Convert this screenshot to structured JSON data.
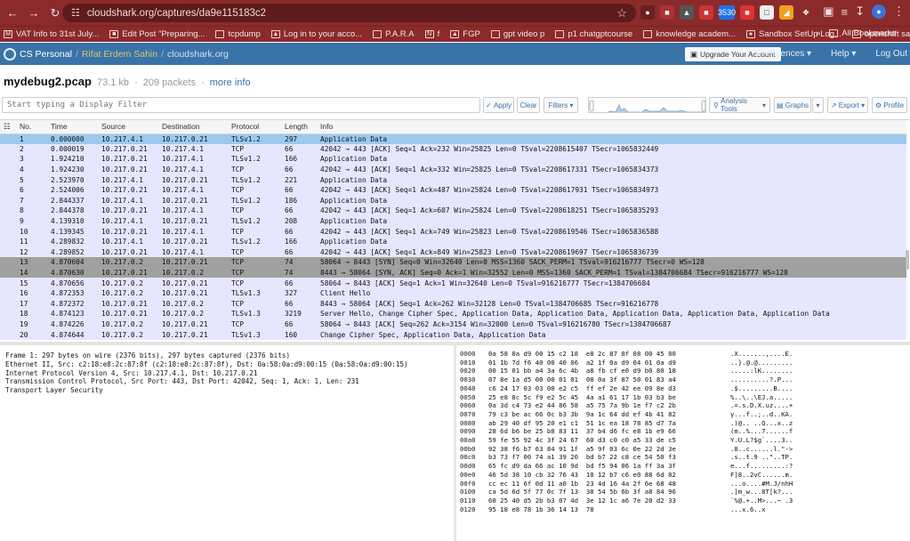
{
  "browser": {
    "url": "cloudshark.org/captures/da9e115183c2",
    "bookmarks": [
      "VAT Info to 31st July...",
      "Edit Post \"Preparing...",
      "tcpdump",
      "Log in to your acco...",
      "P.A.R.A",
      "f",
      "FGP",
      "gpt video p",
      "p1 chatgptcourse",
      "knowledge academ...",
      "Sandbox SetUp Log...",
      "openshift sandbox"
    ],
    "all_bookmarks": "All Bookmarks",
    "badge": "3530"
  },
  "app": {
    "workspace": "CS Personal",
    "user": "Rifat Erdem Sahin",
    "site": "cloudshark.org",
    "upgrade": "Upgrade Your Account",
    "menu": [
      "Preferences",
      "Help",
      "Log Out"
    ]
  },
  "capture": {
    "title": "mydebug2.pcap",
    "size": "73.1 kb",
    "packets": "209 packets",
    "more_info": "more info"
  },
  "toolbar": {
    "filter_placeholder": "Start typing a Display Filter",
    "apply": "Apply",
    "clear": "Clear",
    "filters": "Filters",
    "analysis": "Analysis Tools",
    "graphs": "Graphs",
    "export": "Export",
    "profile": "Profile"
  },
  "table": {
    "columns": [
      "No.",
      "Time",
      "Source",
      "Destination",
      "Protocol",
      "Length",
      "Info"
    ],
    "rows": [
      [
        "1",
        "0.000000",
        "10.217.4.1",
        "10.217.0.21",
        "TLSv1.2",
        "297",
        "Application Data"
      ],
      [
        "2",
        "0.000019",
        "10.217.0.21",
        "10.217.4.1",
        "TCP",
        "66",
        "42042 → 443 [ACK] Seq=1 Ack=232 Win=25825 Len=0 TSval=2208615407 TSecr=1065832449"
      ],
      [
        "3",
        "1.924210",
        "10.217.0.21",
        "10.217.4.1",
        "TLSv1.2",
        "166",
        "Application Data"
      ],
      [
        "4",
        "1.924230",
        "10.217.0.21",
        "10.217.4.1",
        "TCP",
        "66",
        "42042 → 443 [ACK] Seq=1 Ack=332 Win=25825 Len=0 TSval=2208617331 TSecr=1065834373"
      ],
      [
        "5",
        "2.523970",
        "10.217.4.1",
        "10.217.0.21",
        "TLSv1.2",
        "221",
        "Application Data"
      ],
      [
        "6",
        "2.524006",
        "10.217.0.21",
        "10.217.4.1",
        "TCP",
        "66",
        "42042 → 443 [ACK] Seq=1 Ack=487 Win=25824 Len=0 TSval=2208617931 TSecr=1065834973"
      ],
      [
        "7",
        "2.844337",
        "10.217.4.1",
        "10.217.0.21",
        "TLSv1.2",
        "186",
        "Application Data"
      ],
      [
        "8",
        "2.844378",
        "10.217.0.21",
        "10.217.4.1",
        "TCP",
        "66",
        "42042 → 443 [ACK] Seq=1 Ack=607 Win=25824 Len=0 TSval=2208618251 TSecr=1065835293"
      ],
      [
        "9",
        "4.139310",
        "10.217.4.1",
        "10.217.0.21",
        "TLSv1.2",
        "208",
        "Application Data"
      ],
      [
        "10",
        "4.139345",
        "10.217.0.21",
        "10.217.4.1",
        "TCP",
        "66",
        "42042 → 443 [ACK] Seq=1 Ack=749 Win=25823 Len=0 TSval=2208619546 TSecr=1065836588"
      ],
      [
        "11",
        "4.289832",
        "10.217.4.1",
        "10.217.0.21",
        "TLSv1.2",
        "166",
        "Application Data"
      ],
      [
        "12",
        "4.289852",
        "10.217.0.21",
        "10.217.4.1",
        "TCP",
        "66",
        "42042 → 443 [ACK] Seq=1 Ack=849 Win=25823 Len=0 TSval=2208619697 TSecr=1065836739"
      ],
      [
        "13",
        "4.870604",
        "10.217.0.2",
        "10.217.0.21",
        "TCP",
        "74",
        "58064 → 8443 [SYN] Seq=0 Win=32640 Len=0 MSS=1360 SACK_PERM=1 TSval=916216777 TSecr=0 WS=128"
      ],
      [
        "14",
        "4.870630",
        "10.217.0.21",
        "10.217.0.2",
        "TCP",
        "74",
        "8443 → 58064 [SYN, ACK] Seq=0 Ack=1 Win=32552 Len=0 MSS=1360 SACK_PERM=1 TSval=1384706684 TSecr=916216777 WS=128"
      ],
      [
        "15",
        "4.870656",
        "10.217.0.2",
        "10.217.0.21",
        "TCP",
        "66",
        "58064 → 8443 [ACK] Seq=1 Ack=1 Win=32640 Len=0 TSval=916216777 TSecr=1384706684"
      ],
      [
        "16",
        "4.872353",
        "10.217.0.2",
        "10.217.0.21",
        "TLSv1.3",
        "327",
        "Client Hello"
      ],
      [
        "17",
        "4.872372",
        "10.217.0.21",
        "10.217.0.2",
        "TCP",
        "66",
        "8443 → 58064 [ACK] Seq=1 Ack=262 Win=32128 Len=0 TSval=1384706685 TSecr=916216778"
      ],
      [
        "18",
        "4.874123",
        "10.217.0.21",
        "10.217.0.2",
        "TLSv1.3",
        "3219",
        "Server Hello, Change Cipher Spec, Application Data, Application Data, Application Data, Application Data, Application Data"
      ],
      [
        "19",
        "4.874226",
        "10.217.0.2",
        "10.217.0.21",
        "TCP",
        "66",
        "58064 → 8443 [ACK] Seq=262 Ack=3154 Win=32000 Len=0 TSval=916216780 TSecr=1384706687"
      ],
      [
        "20",
        "4.874644",
        "10.217.0.2",
        "10.217.0.21",
        "TLSv1.3",
        "160",
        "Change Cipher Spec, Application Data, Application Data"
      ]
    ]
  },
  "details": [
    "Frame 1: 297 bytes on wire (2376 bits), 297 bytes captured (2376 bits)",
    "Ethernet II, Src: c2:18:e8:2c:87:8f (c2:18:e8:2c:87:8f), Dst: 0a:58:0a:d9:00:15 (0a:58:0a:d9:00:15)",
    "Internet Protocol Version 4, Src: 10.217.4.1, Dst: 10.217.0.21",
    "Transmission Control Protocol, Src Port: 443, Dst Port: 42042, Seq: 1, Ack: 1, Len: 231",
    "Transport Layer Security"
  ],
  "hex": [
    [
      "0000",
      "0a 58 0a d9 00 15 c2 18  e8 2c 87 8f 08 00 45 00",
      ".X.......,....E."
    ],
    [
      "0010",
      "01 1b 7d f6 40 00 40 06  a2 1f 0a d9 04 01 0a d9",
      "..}.@.@........."
    ],
    [
      "0020",
      "00 15 01 bb a4 3a 6c 4b  a8 fb cf e0 d9 b0 80 18",
      ".....:lK........"
    ],
    [
      "0030",
      "07 8e 1a d5 00 00 01 01  08 0a 3f 87 50 01 83 a4",
      "..........?.P..."
    ],
    [
      "0040",
      "c6 24 17 03 03 00 e2 c5  ff ef 2e 42 ee 09 8e d3",
      ".$.........B...."
    ],
    [
      "0050",
      "25 e8 8c 5c f9 e2 5c 45  4a a1 61 17 1b 03 b3 be",
      "%..\\..\\EJ.a....."
    ],
    [
      "0060",
      "0a 3d c4 73 e2 44 86 58  a5 75 7a 9b 1e f7 c2 2b",
      ".=.s.D.X.uz....+"
    ],
    [
      "0070",
      "79 c3 be ac 66 0c b3 3b  9a 1c 64 dd ef 4b 41 82",
      "y...f..;..d..KA."
    ],
    [
      "0080",
      "ab 29 40 df 95 20 e1 c1  51 1c ea 18 78 85 d7 7a",
      ".)@.. ..Q...x..z"
    ],
    [
      "0090",
      "28 6d b6 be 25 b8 83 11  37 b4 d6 fc e8 1b e9 66",
      "(m..%...7......f"
    ],
    [
      "00a0",
      "59 fe 55 92 4c 3f 24 67  60 d3 c0 c0 a5 33 de c5",
      "Y.U.L?$g`....3.."
    ],
    [
      "00b0",
      "92 38 f6 b7 63 84 91 1f  a5 9f 03 6c 0e 22 2d 3e",
      ".8..c......l.\"->"
    ],
    [
      "00c0",
      "b3 73 f7 00 74 a1 39 20  bd b7 22 c8 ce 54 50 f3",
      ".s..t.9 ..\"..TP."
    ],
    [
      "00d0",
      "65 fc d9 da 66 ac 10 9d  bd f5 94 06 1a ff 3a 3f",
      "e...f.........:?"
    ],
    [
      "00e0",
      "46 5d 38 10 cb 32 76 43  10 12 b7 c6 e0 88 6d 82",
      "F]8..2vC......m."
    ],
    [
      "00f0",
      "cc ec 11 6f 0d 11 a0 1b  23 4d 16 4a 2f 6e 68 48",
      "...o....#M.J/nhH"
    ],
    [
      "0100",
      "ca 5d 6d 5f 77 0c 7f 13  38 54 5b 6b 3f a8 84 96",
      ".]m_w...8T[k?..."
    ],
    [
      "0110",
      "60 25 40 d5 2b b3 07 4d  3e 12 1c a6 7e 20 d2 33",
      "`%@.+..M>...~ .3"
    ],
    [
      "0120",
      "95 18 e8 78 1b 36 14 13  78",
      "...x.6..x"
    ]
  ],
  "colors": {
    "chrome": "#8b2a2a",
    "appbar": "#3a73a8",
    "selected_row": "#9cc9f0",
    "tls_row": "#e7e6ff",
    "syn_row": "#a0a0a0"
  }
}
